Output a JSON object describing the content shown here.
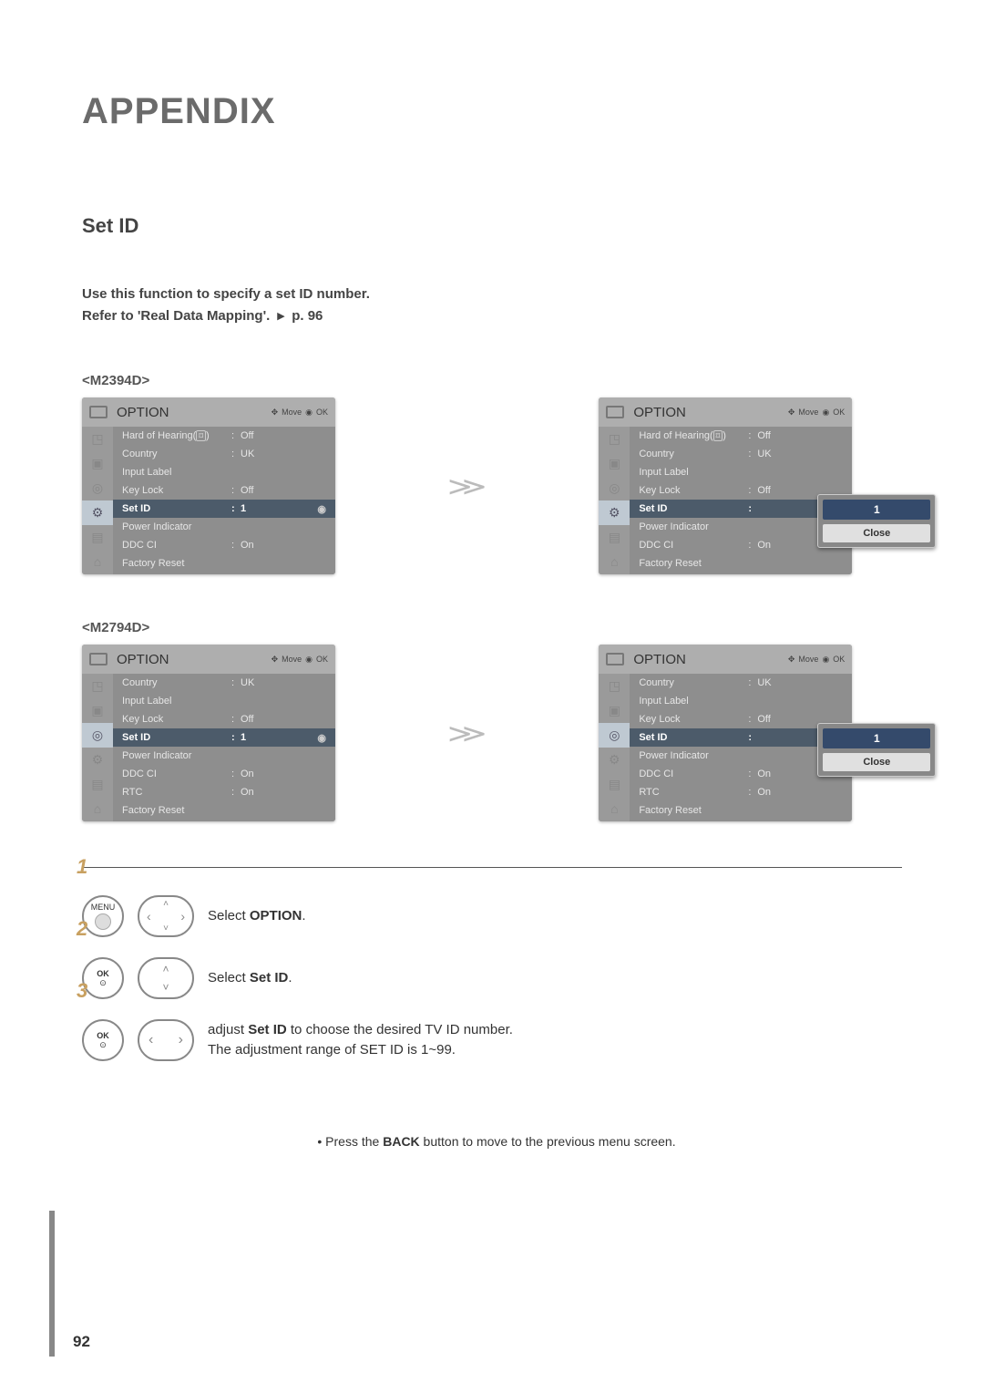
{
  "page": {
    "title": "APPENDIX",
    "section": "Set ID",
    "intro_line1": "Use this function to specify a set ID number.",
    "intro_line2a": "Refer to 'Real Data Mapping'.",
    "intro_line2b": "p. 96",
    "page_number": "92"
  },
  "models": {
    "m2394d": "<M2394D>",
    "m2794d": "<M2794D>"
  },
  "osd": {
    "header_title": "OPTION",
    "move_label": "Move",
    "ok_label": "OK"
  },
  "menu_m2394d": {
    "hard_of_hearing_label": "Hard of Hearing(",
    "hard_of_hearing_suffix": ")",
    "hard_of_hearing_value": "Off",
    "country_label": "Country",
    "country_value": "UK",
    "input_label": "Input Label",
    "key_lock_label": "Key Lock",
    "key_lock_value": "Off",
    "set_id_label": "Set ID",
    "set_id_value": "1",
    "power_indicator_label": "Power Indicator",
    "ddc_ci_label": "DDC CI",
    "ddc_ci_value": "On",
    "factory_reset_label": "Factory Reset"
  },
  "menu_m2794d": {
    "country_label": "Country",
    "country_value": "UK",
    "input_label": "Input Label",
    "key_lock_label": "Key Lock",
    "key_lock_value": "Off",
    "set_id_label": "Set ID",
    "set_id_value": "1",
    "power_indicator_label": "Power Indicator",
    "ddc_ci_label": "DDC CI",
    "ddc_ci_value": "On",
    "rtc_label": "RTC",
    "rtc_value": "On",
    "factory_reset_label": "Factory Reset"
  },
  "popup": {
    "value": "1",
    "close": "Close"
  },
  "steps": {
    "step1_a": "Select ",
    "step1_b": "OPTION",
    "step1_c": ".",
    "step2_a": "Select ",
    "step2_b": "Set ID",
    "step2_c": ".",
    "step3_a": "adjust ",
    "step3_b": "Set ID",
    "step3_c": " to choose the desired TV ID number.",
    "step3_d": "The adjustment range of SET ID is 1~99.",
    "menu_btn": "MENU",
    "ok_btn": "OK"
  },
  "footnote_a": "• Press the ",
  "footnote_b": "BACK",
  "footnote_c": " button to move to the previous menu screen."
}
